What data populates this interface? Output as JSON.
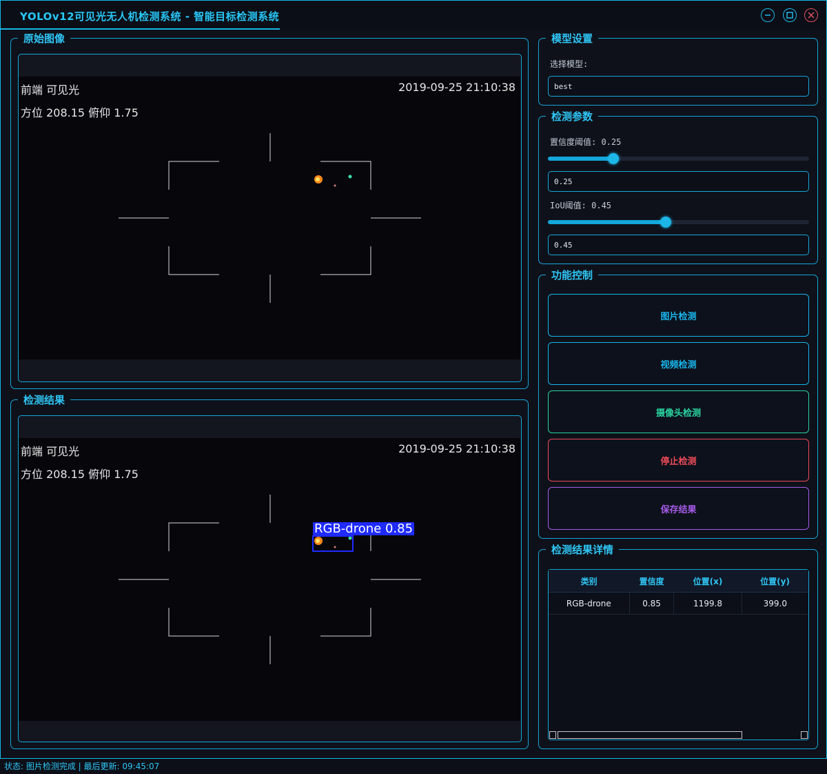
{
  "window": {
    "title": "YOLOv12可见光无人机检测系统 - 智能目标检测系统"
  },
  "original_image": {
    "title": "原始图像",
    "overlay": {
      "channel": "前端  可见光",
      "timestamp": "2019-09-25 21:10:38",
      "orientation": "方位 208.15   俯仰 1.75"
    }
  },
  "detection_result": {
    "title": "检测结果",
    "overlay": {
      "channel": "前端  可见光",
      "timestamp": "2019-09-25 21:10:38",
      "orientation": "方位 208.15   俯仰 1.75"
    },
    "box_label": "RGB-drone 0.85"
  },
  "model_settings": {
    "title": "模型设置",
    "select_label": "选择模型:",
    "selected_model": "best"
  },
  "detection_params": {
    "title": "检测参数",
    "confidence_label": "置信度阈值: 0.25",
    "confidence_value": "0.25",
    "confidence_level": 0.25,
    "iou_label": "IoU阈值: 0.45",
    "iou_value": "0.45",
    "iou_level": 0.45
  },
  "controls": {
    "title": "功能控制",
    "buttons": [
      {
        "label": "图片检测",
        "color": "#18b4ea"
      },
      {
        "label": "视频检测",
        "color": "#18b4ea"
      },
      {
        "label": "摄像头检测",
        "color": "#2ad3a0"
      },
      {
        "label": "停止检测",
        "color": "#ee4b5a"
      },
      {
        "label": "保存结果",
        "color": "#a45be8"
      }
    ]
  },
  "details": {
    "title": "检测结果详情",
    "columns": [
      "类别",
      "置信度",
      "位置(x)",
      "位置(y)"
    ],
    "rows": [
      [
        "RGB-drone",
        "0.85",
        "1199.8",
        "399.0"
      ]
    ]
  },
  "status_bar": {
    "text": "状态: 图片检测完成 | 最后更新: 09:45:07"
  },
  "colors": {
    "accent": "#15b8e8",
    "background": "#0e111a",
    "detection_box": "#1f2bff"
  }
}
